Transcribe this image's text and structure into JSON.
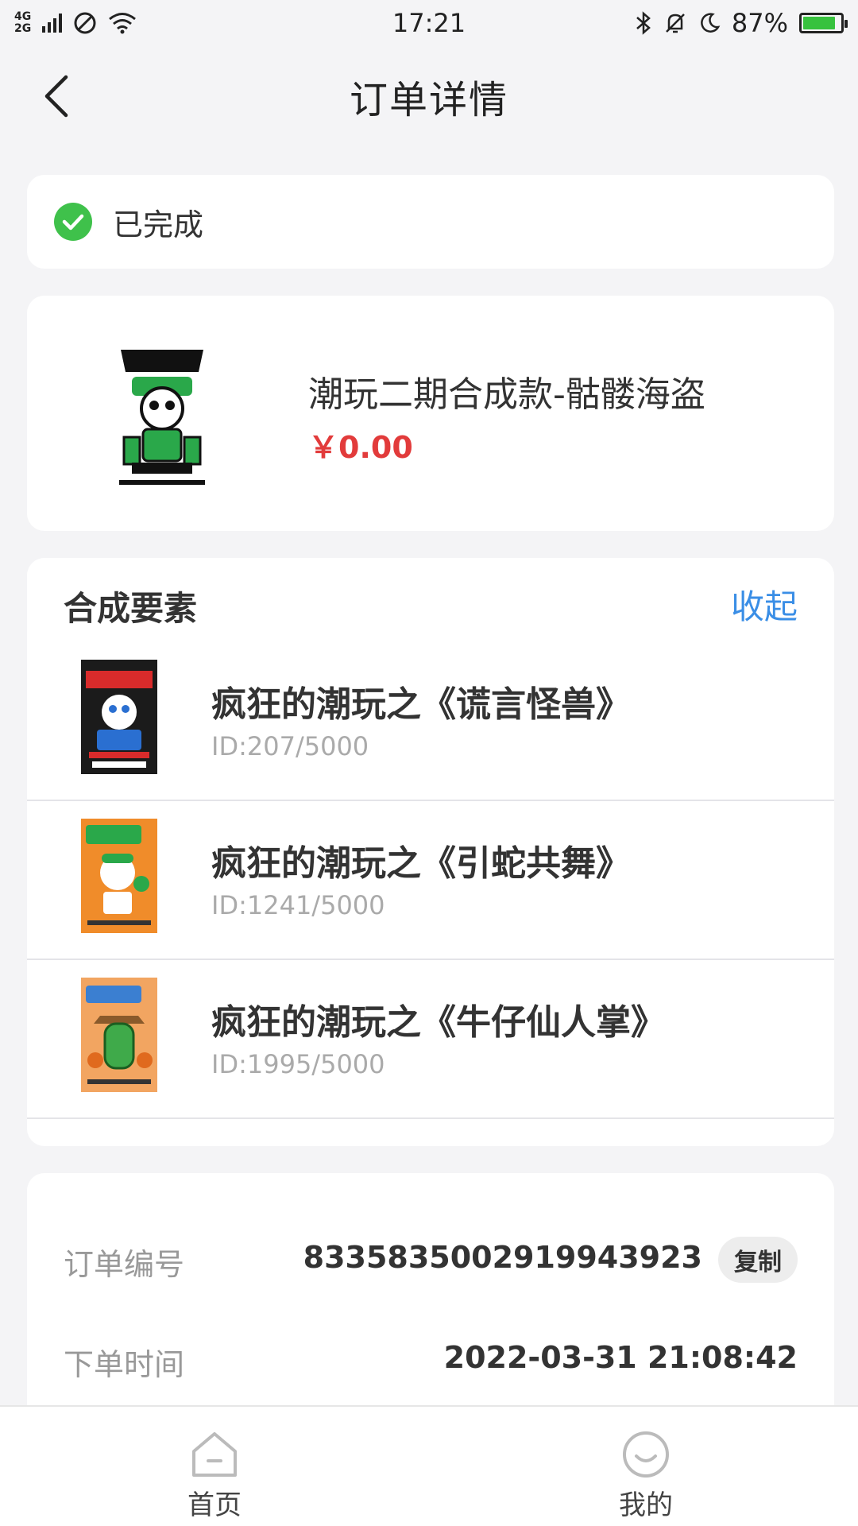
{
  "status_bar": {
    "network": [
      "4G",
      "2G"
    ],
    "time": "17:21",
    "battery": "87%",
    "battery_level": 0.87
  },
  "header": {
    "title": "订单详情"
  },
  "order_status": {
    "text": "已完成",
    "color": "#3fc14b"
  },
  "product": {
    "name": "潮玩二期合成款-骷髅海盗",
    "price": "￥0.00"
  },
  "elements": {
    "title": "合成要素",
    "collapse_label": "收起",
    "items": [
      {
        "name": "疯狂的潮玩之《谎言怪兽》",
        "id": "ID:207/5000",
        "thumb_color": "#1b1b1b"
      },
      {
        "name": "疯狂的潮玩之《引蛇共舞》",
        "id": "ID:1241/5000",
        "thumb_color": "#f08c2a"
      },
      {
        "name": "疯狂的潮玩之《牛仔仙人掌》",
        "id": "ID:1995/5000",
        "thumb_color": "#f2a561"
      }
    ]
  },
  "order_info": {
    "order_no_label": "订单编号",
    "order_no": "8335835002919943923",
    "copy_label": "复制",
    "time_label": "下单时间",
    "time": "2022-03-31 21:08:42"
  },
  "bottom_nav": {
    "home": "首页",
    "mine": "我的"
  },
  "colors": {
    "accent": "#3a8ee6",
    "price": "#e23b3b",
    "success": "#3fc14b"
  }
}
